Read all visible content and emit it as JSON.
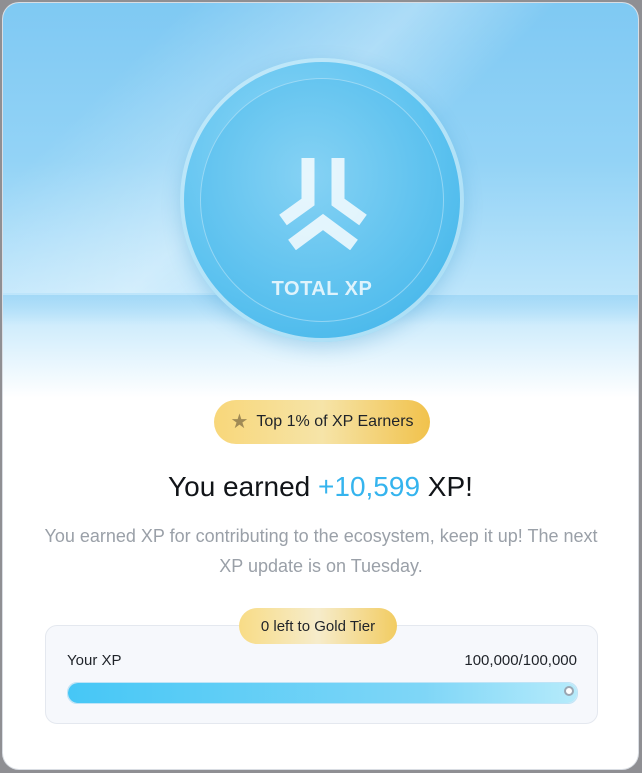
{
  "hero": {
    "coin_label": "TOTAL XP",
    "logo_icon": "xp-logo-icon"
  },
  "badge": {
    "icon": "star-icon",
    "text": "Top 1% of XP Earners"
  },
  "headline": {
    "prefix": "You earned ",
    "amount": "+10,599",
    "suffix": " XP!"
  },
  "description": "You earned XP for contributing to the ecosystem, keep it up! The next XP update is on Tuesday.",
  "progress": {
    "tier_text": "0 left to Gold Tier",
    "label": "Your XP",
    "value_text": "100,000/100,000",
    "fraction": 1.0
  },
  "colors": {
    "accent": "#35b4ee",
    "gold": "#f1c24c"
  }
}
